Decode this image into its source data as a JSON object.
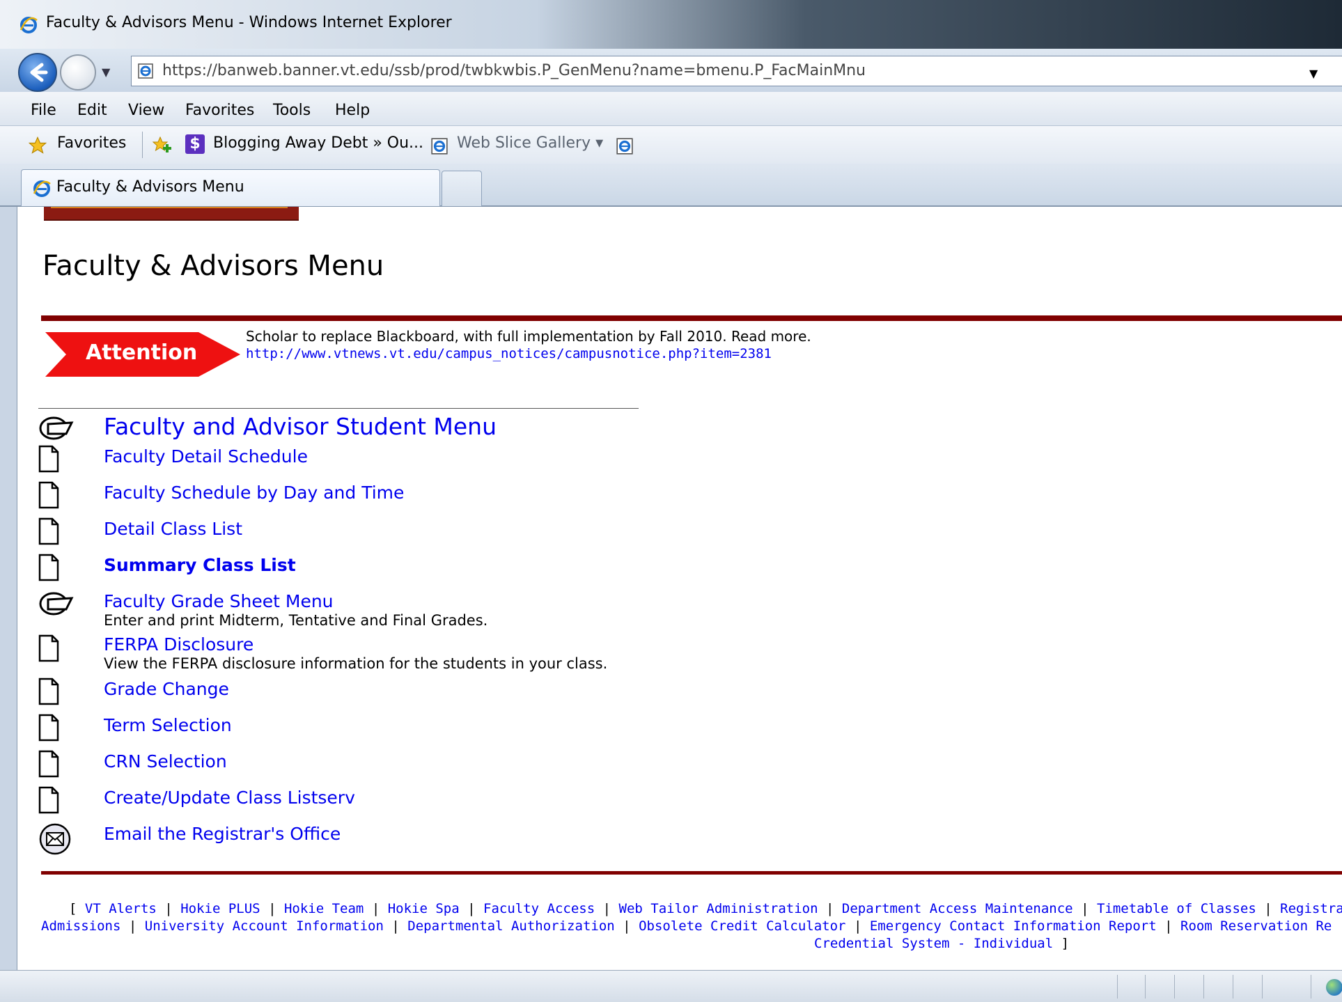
{
  "window": {
    "title": "Faculty & Advisors Menu - Windows Internet Explorer"
  },
  "address_bar": {
    "url": "https://banweb.banner.vt.edu/ssb/prod/twbkwbis.P_GenMenu?name=bmenu.P_FacMainMnu"
  },
  "menu_bar": {
    "items": [
      "File",
      "Edit",
      "View",
      "Favorites",
      "Tools",
      "Help"
    ]
  },
  "favorites_bar": {
    "favorites_label": "Favorites",
    "items": [
      {
        "label": "Blogging Away Debt » Ou..."
      },
      {
        "label": "Web Slice Gallery ▾"
      }
    ]
  },
  "tabs": {
    "active": "Faculty & Advisors Menu"
  },
  "page": {
    "title": "Faculty & Advisors Menu",
    "attention_label": "Attention",
    "notice_text": "Scholar to replace Blackboard, with full implementation by Fall 2010. Read more.",
    "notice_link": "http://www.vtnews.vt.edu/campus_notices/campusnotice.php?item=2381",
    "menu": [
      {
        "label": "Faculty and Advisor Student Menu",
        "icon": "folder-menu-icon"
      },
      {
        "label": "Faculty Detail Schedule",
        "icon": "document-icon"
      },
      {
        "label": "Faculty Schedule by Day and Time",
        "icon": "document-icon"
      },
      {
        "label": "Detail Class List",
        "icon": "document-icon"
      },
      {
        "label": "Summary Class List",
        "icon": "document-icon"
      },
      {
        "label": "Faculty Grade Sheet Menu",
        "desc": "Enter and print Midterm, Tentative and Final Grades.",
        "icon": "folder-menu-icon"
      },
      {
        "label": "FERPA Disclosure",
        "desc": "View the FERPA disclosure information for the students in your class.",
        "icon": "document-icon"
      },
      {
        "label": "Grade Change",
        "icon": "document-icon"
      },
      {
        "label": "Term Selection",
        "icon": "document-icon"
      },
      {
        "label": "CRN Selection",
        "icon": "document-icon"
      },
      {
        "label": "Create/Update Class Listserv",
        "icon": "document-icon"
      },
      {
        "label": "Email the Registrar's Office",
        "icon": "email-icon"
      }
    ],
    "footer_links": [
      "VT Alerts",
      "Hokie PLUS",
      "Hokie Team",
      "Hokie Spa",
      "Faculty Access",
      "Web Tailor Administration",
      "Department Access Maintenance",
      "Timetable of Classes",
      "Registrar",
      "Admissions",
      "University Account Information",
      "Departmental Authorization",
      "Obsolete Credit Calculator",
      "Emergency Contact Information Report",
      "Room Reservation Re",
      "Credential System - Individual"
    ],
    "footer_open": "[",
    "footer_close": "]",
    "footer_sep": "|"
  },
  "colors": {
    "link": "#0000ee",
    "rule": "#800000",
    "attention": "#ee1111"
  }
}
